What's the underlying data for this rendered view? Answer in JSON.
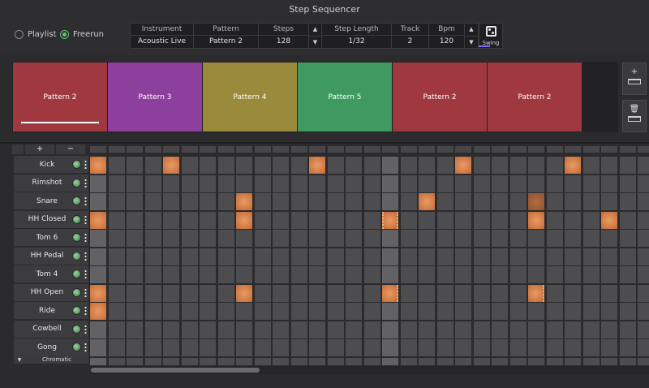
{
  "window": {
    "title": "Step Sequencer"
  },
  "mode": {
    "options": [
      "Playlist",
      "Freerun"
    ],
    "selected": "Freerun"
  },
  "info": {
    "instrument": {
      "header": "Instrument",
      "value": "Acoustic Live"
    },
    "pattern": {
      "header": "Pattern",
      "value": "Pattern 2"
    },
    "steps": {
      "header": "Steps",
      "value": "128"
    },
    "step_length": {
      "header": "Step Length",
      "value": "1/32"
    },
    "track": {
      "header": "Track",
      "value": "2"
    },
    "bpm": {
      "header": "Bpm",
      "value": "120"
    }
  },
  "swing": {
    "label": "Swing",
    "icon": "dice-icon"
  },
  "patterns": [
    {
      "label": "Pattern 2",
      "color": "#a0393f",
      "selected": true
    },
    {
      "label": "Pattern 3",
      "color": "#8c3f9c"
    },
    {
      "label": "Pattern 4",
      "color": "#9a8a3c"
    },
    {
      "label": "Pattern 5",
      "color": "#3e9a5e"
    },
    {
      "label": "Pattern 2",
      "color": "#a0393f"
    },
    {
      "label": "Pattern 2",
      "color": "#a0393f"
    }
  ],
  "pattern_actions": {
    "add_symbol": "+",
    "delete_icon": "trash-icon"
  },
  "instrument_controls": {
    "add": "+",
    "remove": "−",
    "scale": "Chromatic"
  },
  "instruments": [
    {
      "name": "Kick"
    },
    {
      "name": "Rimshot"
    },
    {
      "name": "Snare"
    },
    {
      "name": "HH Closed"
    },
    {
      "name": "Tom 6"
    },
    {
      "name": "HH Pedal"
    },
    {
      "name": "Tom 4"
    },
    {
      "name": "HH Open"
    },
    {
      "name": "Ride"
    },
    {
      "name": "Cowbell"
    },
    {
      "name": "Gong"
    }
  ],
  "grid": {
    "visible_steps": 31,
    "highlight_columns": [
      0,
      16
    ],
    "active": {
      "0": [
        0,
        4,
        12,
        20,
        26
      ],
      "2": [
        8,
        18,
        24
      ],
      "3": [
        0,
        8,
        16,
        24,
        28
      ],
      "7": [
        0,
        8,
        16,
        24
      ],
      "8": [
        0
      ]
    },
    "dim": {
      "2": [
        24
      ],
      "3": [
        4,
        12,
        20
      ]
    },
    "dashed_right": {
      "3": [
        16
      ],
      "7": [
        16,
        24
      ]
    },
    "dashed_left": {
      "3": [
        16
      ]
    }
  },
  "scroll": {
    "position": 0.0
  }
}
